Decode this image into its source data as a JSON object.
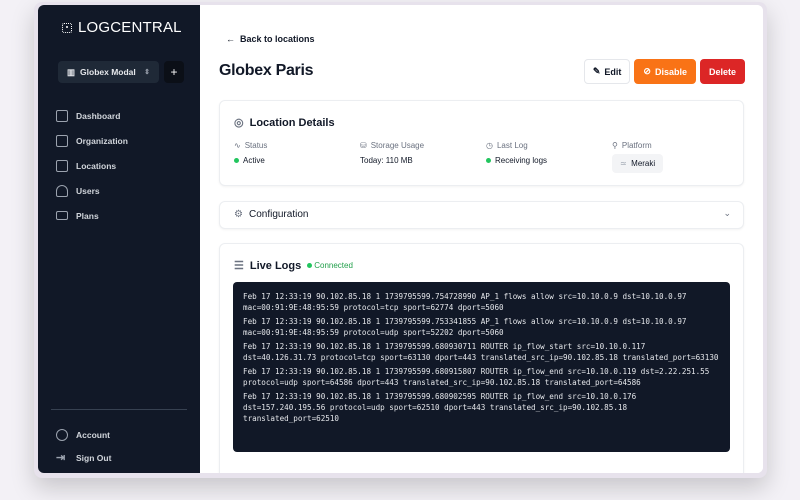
{
  "app": {
    "name": "LOGCENTRAL"
  },
  "sidebar": {
    "org": "Globex Modal",
    "add": "+",
    "items": [
      {
        "label": "Dashboard"
      },
      {
        "label": "Organization"
      },
      {
        "label": "Locations"
      },
      {
        "label": "Users"
      },
      {
        "label": "Plans"
      }
    ],
    "bottom": [
      {
        "label": "Account"
      },
      {
        "label": "Sign Out"
      }
    ]
  },
  "header": {
    "back": "Back to locations",
    "title": "Globex Paris",
    "edit": "Edit",
    "disable": "Disable",
    "delete": "Delete"
  },
  "details": {
    "title": "Location Details",
    "status": {
      "label": "Status",
      "value": "Active"
    },
    "storage": {
      "label": "Storage Usage",
      "value": "Today: 110 MB"
    },
    "last_log": {
      "label": "Last Log",
      "value": "Receiving logs"
    },
    "platform": {
      "label": "Platform",
      "value": "Meraki"
    }
  },
  "config": {
    "title": "Configuration"
  },
  "live": {
    "title": "Live Logs",
    "status": "Connected",
    "entries": [
      "Feb 17 12:33:19 90.102.85.18 1 1739795599.754728990 AP_1 flows allow src=10.10.0.9 dst=10.10.0.97 mac=00:91:9E:48:95:59 protocol=tcp sport=62774 dport=5060",
      "Feb 17 12:33:19 90.102.85.18 1 1739795599.753341855 AP_1 flows allow src=10.10.0.9 dst=10.10.0.97 mac=00:91:9E:48:95:59 protocol=udp sport=52202 dport=5060",
      "Feb 17 12:33:19 90.102.85.18 1 1739795599.680930711 ROUTER ip_flow_start src=10.10.0.117 dst=40.126.31.73 protocol=tcp sport=63130 dport=443 translated_src_ip=90.102.85.18 translated_port=63130",
      "Feb 17 12:33:19 90.102.85.18 1 1739795599.680915807 ROUTER ip_flow_end src=10.10.0.119 dst=2.22.251.55 protocol=udp sport=64586 dport=443 translated_src_ip=90.102.85.18 translated_port=64586",
      "Feb 17 12:33:19 90.102.85.18 1 1739795599.680902595 ROUTER ip_flow_end src=10.10.0.176 dst=157.240.195.56 protocol=udp sport=62510 dport=443 translated_src_ip=90.102.85.18 translated_port=62510"
    ]
  },
  "colors": {
    "sidebar": "#111827",
    "disable": "#f97316",
    "delete": "#dc2626",
    "success": "#22c55e"
  }
}
